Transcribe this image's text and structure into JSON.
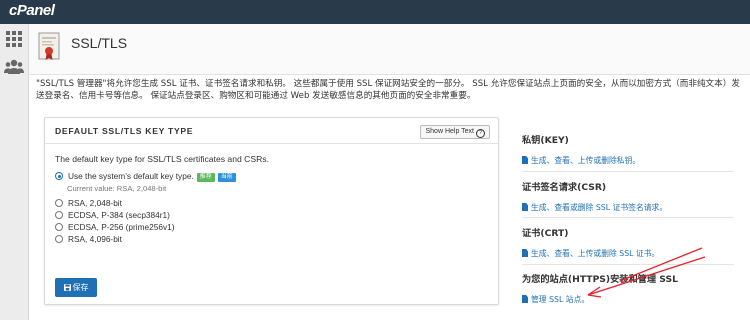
{
  "header": {
    "logo": "cPanel"
  },
  "sidebar": {
    "icons": [
      "grid-icon",
      "users-icon"
    ]
  },
  "page": {
    "title": "SSL/TLS",
    "description": "\"SSL/TLS 管理器\"将允许您生成 SSL 证书、证书签名请求和私钥。 这些都属于使用 SSL 保证网站安全的一部分。 SSL 允许您保证站点上页面的安全，从而以加密方式（而非纯文本）发送登录名、信用卡号等信息。 保证站点登录区、购物区和可能通过 Web 发送敏感信息的其他页面的安全非常重要。"
  },
  "panel": {
    "title": "DEFAULT SSL/TLS KEY TYPE",
    "help_label": "Show Help Text",
    "intro": "The default key type for SSL/TLS certificates and CSRs.",
    "options": [
      {
        "label": "Use the system’s default key type.",
        "checked": true
      },
      {
        "label": "RSA, 2,048-bit",
        "checked": false
      },
      {
        "label": "ECDSA, P-384 (secp384r1)",
        "checked": false
      },
      {
        "label": "ECDSA, P-256 (prime256v1)",
        "checked": false
      },
      {
        "label": "RSA, 4,096-bit",
        "checked": false
      }
    ],
    "badge_recommended": "推荐",
    "badge_current": "当前",
    "current_value": "Current value: RSA, 2,048-bit",
    "save_label": "保存"
  },
  "right": {
    "sections": [
      {
        "heading": "私钥(KEY)",
        "link": "生成、查看、上传或删除私钥。"
      },
      {
        "heading": "证书签名请求(CSR)",
        "link": "生成、查看或删除 SSL 证书签名请求。"
      },
      {
        "heading": "证书(CRT)",
        "link": "生成、查看、上传或删除 SSL 证书。"
      },
      {
        "heading": "为您的站点(HTTPS)安装和管理 SSL",
        "link": "管理 SSL 站点。"
      }
    ]
  },
  "colors": {
    "topbar": "#293a4a",
    "accent": "#1f6fb5",
    "annotation_arrow": "#e8202a"
  }
}
